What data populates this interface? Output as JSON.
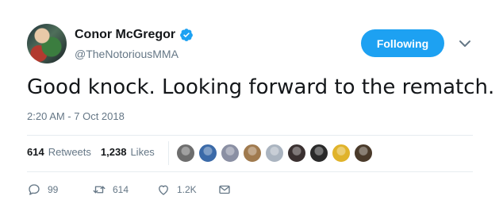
{
  "user": {
    "display_name": "Conor McGregor",
    "handle": "@TheNotoriousMMA",
    "verified_icon": "verified-badge-icon",
    "follow_label": "Following",
    "brand_color": "#1da1f2"
  },
  "tweet": {
    "text": "Good knock. Looking forward to the rematch.",
    "timestamp": "2:20 AM - 7 Oct 2018"
  },
  "stats": {
    "retweets_count": "614",
    "retweets_label": "Retweets",
    "likes_count": "1,238",
    "likes_label": "Likes"
  },
  "likers": [
    {
      "color": "#6d6d6d"
    },
    {
      "color": "#3b6aa8"
    },
    {
      "color": "#8a8fa3"
    },
    {
      "color": "#a07a4e"
    },
    {
      "color": "#aab4c0"
    },
    {
      "color": "#3a3030"
    },
    {
      "color": "#2a2a2a"
    },
    {
      "color": "#e0b32a"
    },
    {
      "color": "#4a3a2a"
    }
  ],
  "actions": {
    "reply_count": "99",
    "retweet_count": "614",
    "like_count": "1.2K"
  }
}
